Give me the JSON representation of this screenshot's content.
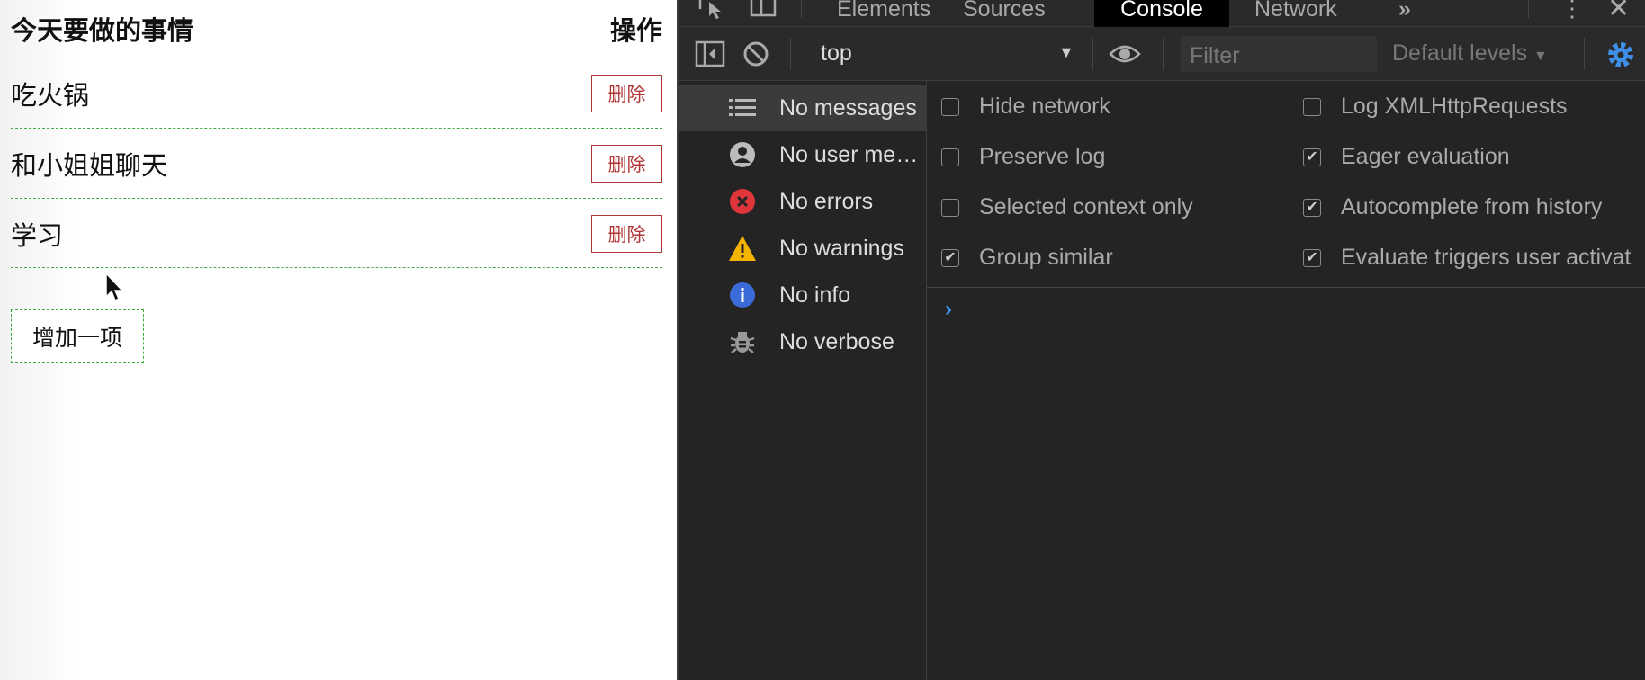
{
  "todo": {
    "header_title": "今天要做的事情",
    "header_action": "操作",
    "items": [
      {
        "text": "吃火锅",
        "delete_label": "删除"
      },
      {
        "text": "和小姐姐聊天",
        "delete_label": "删除"
      },
      {
        "text": "学习",
        "delete_label": "删除"
      }
    ],
    "add_label": "增加一项",
    "colors": {
      "dashed_border": "#3cab3c",
      "delete_red": "#b03535"
    }
  },
  "devtools": {
    "tabs": [
      "Elements",
      "Sources",
      "Console",
      "Network"
    ],
    "active_tab": "Console",
    "toolbar": {
      "context": "top",
      "filter_placeholder": "Filter",
      "levels": "Default levels"
    },
    "sidebar": [
      {
        "label": "No messages",
        "icon": "list-icon",
        "selected": true
      },
      {
        "label": "No user me…",
        "icon": "user-icon",
        "selected": false
      },
      {
        "label": "No errors",
        "icon": "error-icon",
        "selected": false
      },
      {
        "label": "No warnings",
        "icon": "warning-icon",
        "selected": false
      },
      {
        "label": "No info",
        "icon": "info-icon",
        "selected": false
      },
      {
        "label": "No verbose",
        "icon": "bug-icon",
        "selected": false
      }
    ],
    "settings": {
      "hide_network": {
        "label": "Hide network",
        "checked": false
      },
      "preserve_log": {
        "label": "Preserve log",
        "checked": false
      },
      "selected_context": {
        "label": "Selected context only",
        "checked": false
      },
      "group_similar": {
        "label": "Group similar",
        "checked": true
      },
      "log_xhr": {
        "label": "Log XMLHttpRequests",
        "checked": false
      },
      "eager_eval": {
        "label": "Eager evaluation",
        "checked": true
      },
      "autocomplete": {
        "label": "Autocomplete from history",
        "checked": true
      },
      "evaluate_triggers": {
        "label": "Evaluate triggers user activat",
        "checked": true
      }
    },
    "prompt": "›",
    "colors": {
      "background": "#242424",
      "accent": "#3d8fe8",
      "error": "#e0353b",
      "warning": "#f4b400",
      "info": "#3b6bd9"
    }
  }
}
